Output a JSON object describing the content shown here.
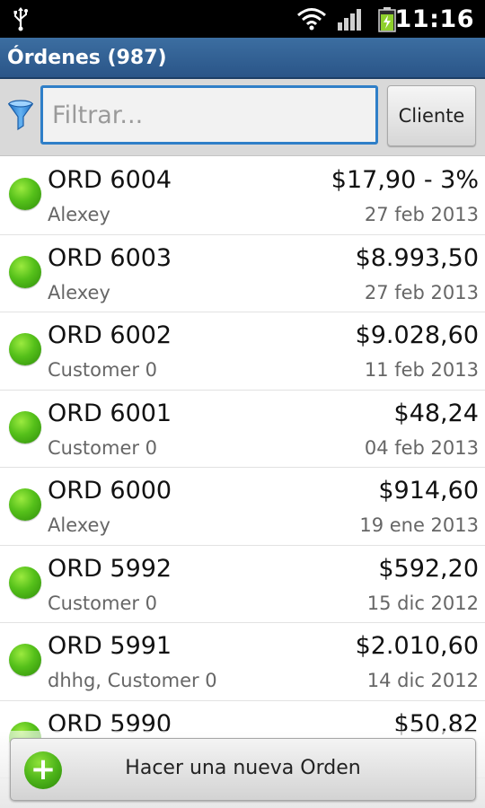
{
  "status_bar": {
    "time": "11:16",
    "icons": [
      "usb-icon",
      "wifi-icon",
      "signal-icon",
      "battery-icon"
    ]
  },
  "header": {
    "title": "Órdenes (987)"
  },
  "filter": {
    "placeholder": "Filtrar...",
    "value": "",
    "client_button_label": "Cliente",
    "icon": "funnel-icon"
  },
  "orders": [
    {
      "id": "ORD 6004",
      "customer": "Alexey",
      "amount": "$17,90 - 3%",
      "date": "27 feb 2013",
      "status_color": "#4eb51a"
    },
    {
      "id": "ORD 6003",
      "customer": "Alexey",
      "amount": "$8.993,50",
      "date": "27 feb 2013",
      "status_color": "#4eb51a"
    },
    {
      "id": "ORD 6002",
      "customer": "Customer 0",
      "amount": "$9.028,60",
      "date": "11 feb 2013",
      "status_color": "#4eb51a"
    },
    {
      "id": "ORD 6001",
      "customer": "Customer 0",
      "amount": "$48,24",
      "date": "04 feb 2013",
      "status_color": "#4eb51a"
    },
    {
      "id": "ORD 6000",
      "customer": "Alexey",
      "amount": "$914,60",
      "date": "19 ene 2013",
      "status_color": "#4eb51a"
    },
    {
      "id": "ORD 5992",
      "customer": "Customer 0",
      "amount": "$592,20",
      "date": "15 dic 2012",
      "status_color": "#4eb51a"
    },
    {
      "id": "ORD 5991",
      "customer": "dhhg, Customer 0",
      "amount": "$2.010,60",
      "date": "14 dic 2012",
      "status_color": "#4eb51a"
    },
    {
      "id": "ORD 5990",
      "customer": "",
      "amount": "$50,82",
      "date": "",
      "status_color": "#4eb51a"
    }
  ],
  "footer": {
    "new_order_label": "Hacer una nueva Orden",
    "icon": "plus-icon"
  },
  "colors": {
    "accent": "#2f7fc8",
    "title_bar": "#2f5f94",
    "status_ok": "#4eb51a"
  }
}
